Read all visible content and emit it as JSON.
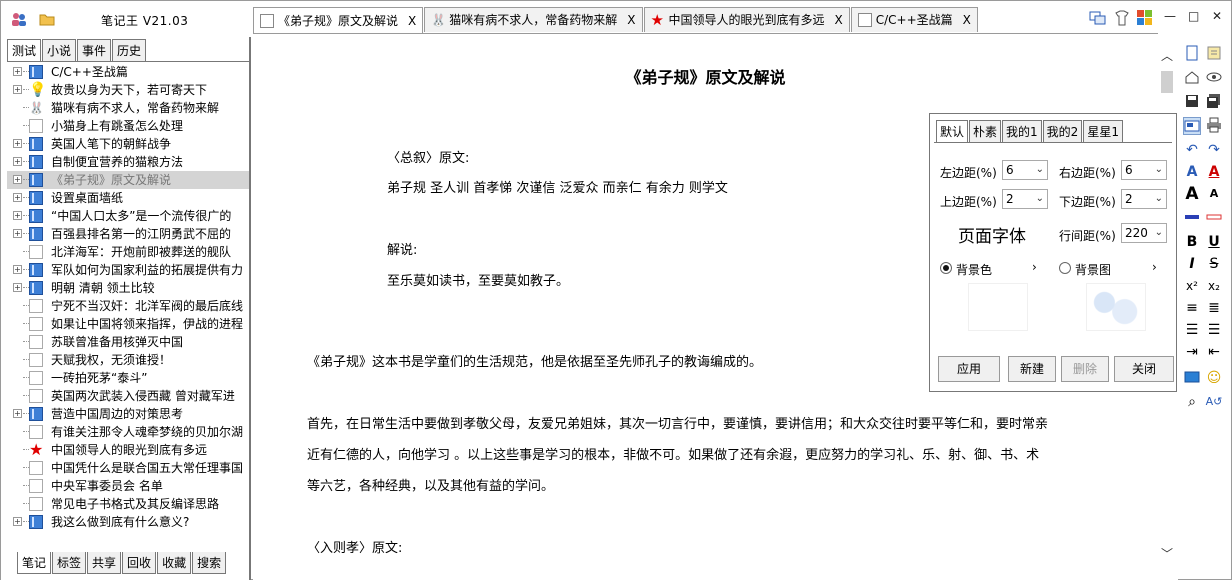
{
  "app": {
    "title": "笔记王 V21.03"
  },
  "left_tabs": [
    "测试",
    "小说",
    "事件",
    "历史"
  ],
  "bottom_tabs": [
    "笔记",
    "标签",
    "共享",
    "回收",
    "收藏",
    "搜索"
  ],
  "tree": [
    {
      "label": "C/C++圣战篇",
      "icon": "book",
      "expand": true
    },
    {
      "label": "故贵以身为天下，若可寄天下",
      "icon": "bulb",
      "expand": true
    },
    {
      "label": "猫咪有病不求人，常备药物来解",
      "icon": "cat",
      "expand": false
    },
    {
      "label": "小猫身上有跳蚤怎么处理",
      "icon": "doc",
      "expand": false
    },
    {
      "label": "英国人笔下的朝鲜战争",
      "icon": "book",
      "expand": true
    },
    {
      "label": "自制便宜营养的猫粮方法",
      "icon": "book",
      "expand": true
    },
    {
      "label": "《弟子规》原文及解说",
      "icon": "book",
      "expand": true,
      "selected": true
    },
    {
      "label": "设置桌面墙纸",
      "icon": "book",
      "expand": true
    },
    {
      "label": "“中国人口太多”是一个流传很广的",
      "icon": "book",
      "expand": true
    },
    {
      "label": "百强县排名第一的江阴勇武不屈的",
      "icon": "book",
      "expand": true
    },
    {
      "label": "北洋海军：开炮前即被葬送的舰队",
      "icon": "doc",
      "expand": false
    },
    {
      "label": "军队如何为国家利益的拓展提供有力",
      "icon": "book",
      "expand": true
    },
    {
      "label": "明朝 清朝 领土比较",
      "icon": "book",
      "expand": true
    },
    {
      "label": "宁死不当汉奸：北洋军阀的最后底线",
      "icon": "doc",
      "expand": false
    },
    {
      "label": "如果让中国将领来指挥，伊战的进程",
      "icon": "doc",
      "expand": false
    },
    {
      "label": "苏联曾准备用核弹灭中国",
      "icon": "doc",
      "expand": false
    },
    {
      "label": "天赋我权，无须谁授！",
      "icon": "doc",
      "expand": false
    },
    {
      "label": "一砖拍死茅“泰斗”",
      "icon": "doc",
      "expand": false
    },
    {
      "label": "英国两次武装入侵西藏 曾对藏军进",
      "icon": "doc",
      "expand": false
    },
    {
      "label": "营造中国周边的对策思考",
      "icon": "book",
      "expand": true
    },
    {
      "label": "有谁关注那令人魂牵梦绕的贝加尔湖",
      "icon": "doc",
      "expand": false
    },
    {
      "label": "中国领导人的眼光到底有多远",
      "icon": "star",
      "expand": false
    },
    {
      "label": "中国凭什么是联合国五大常任理事国",
      "icon": "doc",
      "expand": false
    },
    {
      "label": "中央军事委员会 名单",
      "icon": "doc",
      "expand": false
    },
    {
      "label": "常见电子书格式及其反编译思路",
      "icon": "doc",
      "expand": false
    },
    {
      "label": "我这么做到底有什么意义?",
      "icon": "book",
      "expand": true
    }
  ],
  "doc_tabs": [
    {
      "label": "《弟子规》原文及解说",
      "close": "X",
      "icon": "doc",
      "active": true
    },
    {
      "label": "猫咪有病不求人，常备药物来解",
      "close": "X",
      "icon": "cat"
    },
    {
      "label": "中国领导人的眼光到底有多远",
      "close": "X",
      "icon": "star"
    },
    {
      "label": "C/C++圣战篇",
      "close": "X",
      "icon": "doc"
    }
  ],
  "document": {
    "title": "《弟子规》原文及解说",
    "lines": [
      "〈总叙〉原文:",
      "弟子规 圣人训 首孝悌 次谨信 泛爱众 而亲仁 有余力 则学文",
      "解说:",
      "至乐莫如读书，至要莫如教子。",
      "《弟子规》这本书是学童们的生活规范，他是依据至圣先师孔子的教诲编成的。",
      "首先，在日常生活中要做到孝敬父母，友爱兄弟姐妹，其次一切言行中，要谨慎，要讲信用；和大众交往时要平等仁和，要时常亲",
      "近有仁德的人，向他学习 。以上这些事是学习的根本，非做不可。如果做了还有余遐，更应努力的学习礼、乐、射、御、书、术",
      "等六艺，各种经典，以及其他有益的学问。",
      "〈入则孝〉原文:"
    ]
  },
  "page_panel": {
    "tabs": [
      "默认",
      "朴素",
      "我的1",
      "我的2",
      "星星1"
    ],
    "left_margin_label": "左边距(%)",
    "left_margin": "6",
    "right_margin_label": "右边距(%)",
    "right_margin": "6",
    "top_margin_label": "上边距(%)",
    "top_margin": "2",
    "bottom_margin_label": "下边距(%)",
    "bottom_margin": "2",
    "font_label": "页面字体",
    "line_spacing_label": "行间距(%)",
    "line_spacing": "220",
    "bg_color_label": "背景色",
    "bg_image_label": "背景图",
    "bg_mode": "color",
    "apply": "应用",
    "new": "新建",
    "delete": "删除",
    "close": "关闭"
  },
  "colors": {
    "selected_row": "#d4d4d4",
    "book_icon": "#3d7fd6",
    "star_icon": "#e00000"
  }
}
